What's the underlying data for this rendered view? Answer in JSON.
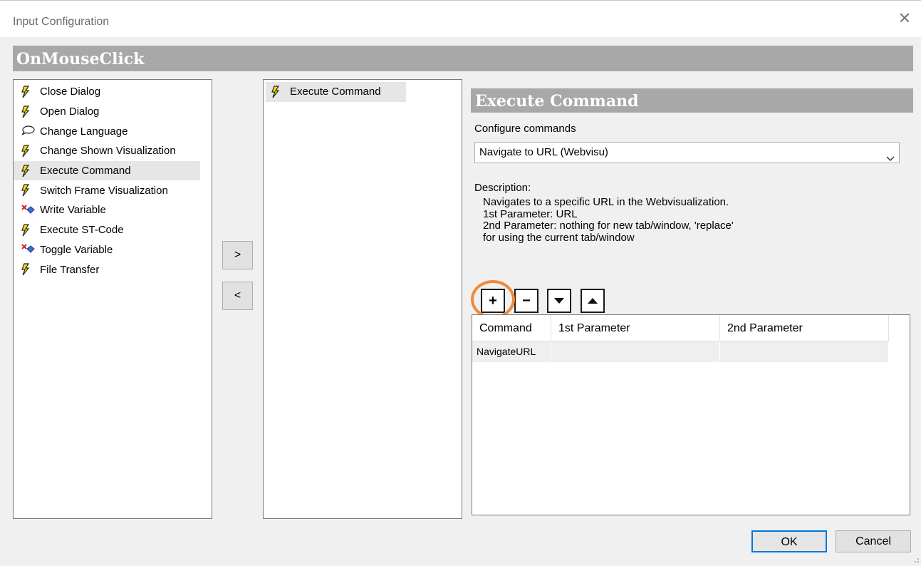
{
  "window": {
    "title": "Input Configuration"
  },
  "header": {
    "title": "OnMouseClick"
  },
  "left_list": {
    "items": [
      {
        "label": "Close Dialog",
        "icon": "lightning-icon",
        "selected": false
      },
      {
        "label": "Open Dialog",
        "icon": "lightning-icon",
        "selected": false
      },
      {
        "label": "Change Language",
        "icon": "speech-bubble-icon",
        "selected": false
      },
      {
        "label": "Change Shown Visualization",
        "icon": "lightning-icon",
        "selected": false
      },
      {
        "label": "Execute Command",
        "icon": "lightning-icon",
        "selected": true
      },
      {
        "label": "Switch Frame Visualization",
        "icon": "lightning-icon",
        "selected": false
      },
      {
        "label": "Write Variable",
        "icon": "variable-icon",
        "selected": false
      },
      {
        "label": "Execute ST-Code",
        "icon": "lightning-icon",
        "selected": false
      },
      {
        "label": "Toggle Variable",
        "icon": "variable-icon",
        "selected": false
      },
      {
        "label": "File Transfer",
        "icon": "lightning-icon",
        "selected": false
      }
    ]
  },
  "middle_list": {
    "items": [
      {
        "label": "Execute Command",
        "icon": "lightning-icon",
        "selected": true
      }
    ]
  },
  "move_buttons": {
    "right": ">",
    "left": "<"
  },
  "detail": {
    "title": "Execute Command",
    "configure_label": "Configure commands",
    "command_select": "Navigate to URL (Webvisu)",
    "description_label": "Description:",
    "description": "Navigates to a specific URL in the Webvisualization.\n1st Parameter: URL\n2nd Parameter: nothing for new tab/window, 'replace'\nfor using the current tab/window",
    "toolbar": {
      "add": "+",
      "remove": "−"
    },
    "table": {
      "columns": [
        "Command",
        "1st Parameter",
        "2nd Parameter"
      ],
      "rows": [
        [
          "NavigateURL",
          "",
          ""
        ]
      ]
    }
  },
  "footer": {
    "ok": "OK",
    "cancel": "Cancel"
  },
  "colors": {
    "header_gray": "#a8a8a8",
    "highlight_ring": "#ee8a3a",
    "lightning": "#f5e600",
    "ok_border": "#0078d7"
  }
}
